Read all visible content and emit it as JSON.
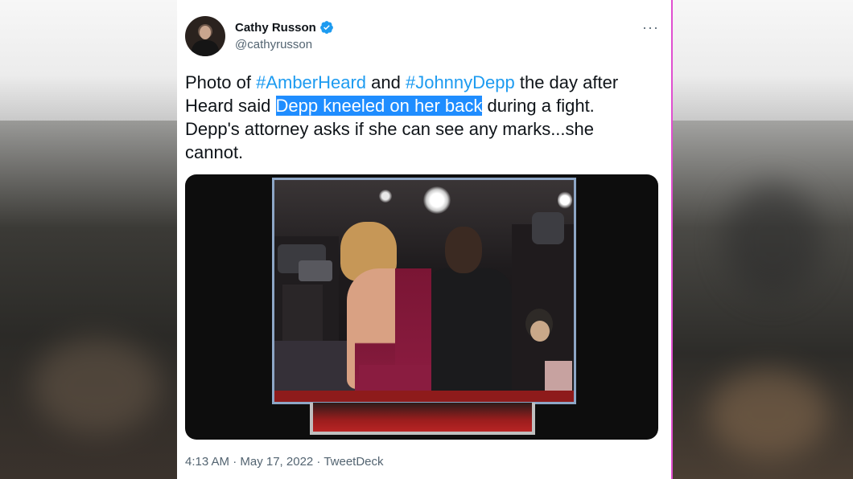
{
  "tweet": {
    "author_name": "Cathy Russon",
    "author_handle": "@cathyrusson",
    "text_parts": {
      "p1": "Photo of ",
      "tag1": "#AmberHeard",
      "p2": " and ",
      "tag2": "#JohnnyDepp",
      "p3": " the day after Heard said ",
      "highlight": "Depp kneeled on her back",
      "p4": " during a fight.  Depp's attorney asks if she can see any marks...she cannot."
    },
    "meta": "4:13 AM · May 17, 2022 · TweetDeck",
    "more_label": "···"
  },
  "icons": {
    "verified": "verified-badge-icon",
    "more": "more-options-icon"
  },
  "colors": {
    "hashtag": "#1d9bf0",
    "highlight": "#1f8dff",
    "text": "#0f1419",
    "secondary": "#536471",
    "edge_accent": "#e04fd0"
  }
}
